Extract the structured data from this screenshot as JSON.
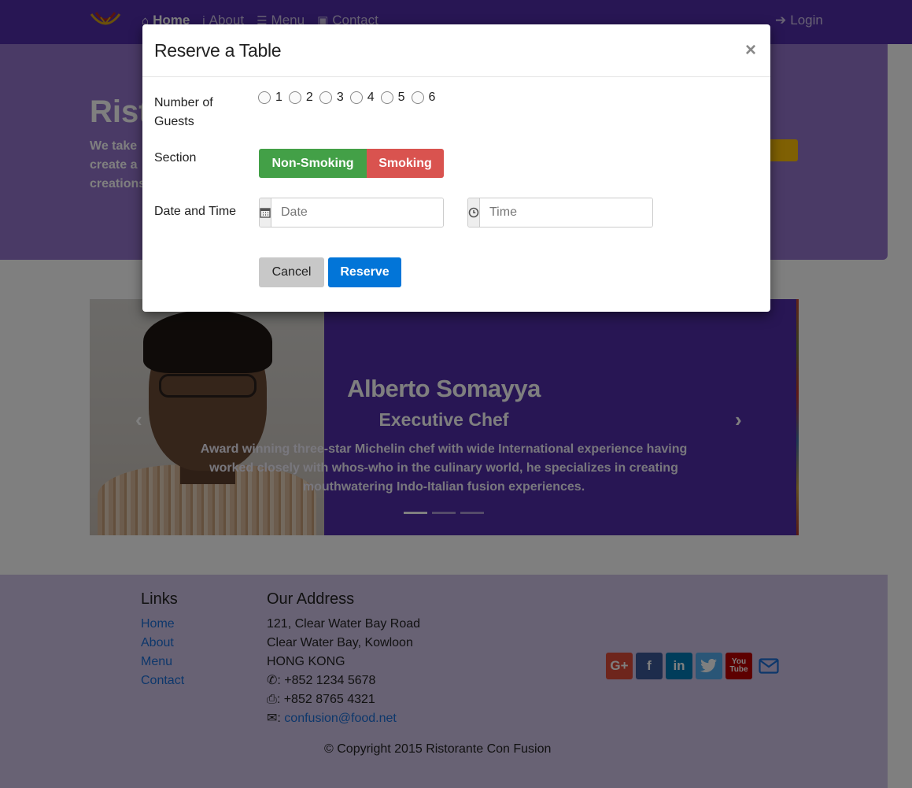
{
  "navbar": {
    "links": [
      {
        "icon": "home-icon",
        "label": "Home"
      },
      {
        "icon": "info-icon",
        "label": "About"
      },
      {
        "icon": "list-icon",
        "label": "Menu"
      },
      {
        "icon": "address-card-icon",
        "label": "Contact"
      }
    ],
    "login_label": "Login"
  },
  "jumbotron": {
    "title": "Rist",
    "text": "We take create a creations"
  },
  "carousel": {
    "name": "Alberto Somayya",
    "role": "Executive Chef",
    "description": "Award winning three-star Michelin chef with wide International experience having worked closely with whos-who in the culinary world, he specializes in creating mouthwatering Indo-Italian fusion experiences.",
    "active_slide": 1,
    "slide_count": 3
  },
  "modal": {
    "title": "Reserve a Table",
    "close_symbol": "×",
    "guests": {
      "label": "Number of Guests",
      "options": [
        "1",
        "2",
        "3",
        "4",
        "5",
        "6"
      ]
    },
    "section": {
      "label": "Section",
      "non_smoking": "Non-Smoking",
      "smoking": "Smoking"
    },
    "datetime": {
      "label": "Date and Time",
      "date_placeholder": "Date",
      "time_placeholder": "Time"
    },
    "cancel_label": "Cancel",
    "reserve_label": "Reserve"
  },
  "footer": {
    "links_heading": "Links",
    "links": [
      "Home",
      "About",
      "Menu",
      "Contact"
    ],
    "address_heading": "Our Address",
    "address_lines": [
      "121, Clear Water Bay Road",
      "Clear Water Bay, Kowloon",
      "HONG KONG"
    ],
    "phone": ": +852 1234 5678",
    "fax": ": +852 8765 4321",
    "email": "confusion@food.net",
    "copyright": "© Copyright 2015 Ristorante Con Fusion"
  },
  "colors": {
    "navbar": "#512DA8",
    "jumbotron": "#9575CD",
    "footer": "#D1C4E9",
    "non_smoking": "#43a047",
    "smoking": "#d9534f",
    "reserve": "#0275d8"
  }
}
